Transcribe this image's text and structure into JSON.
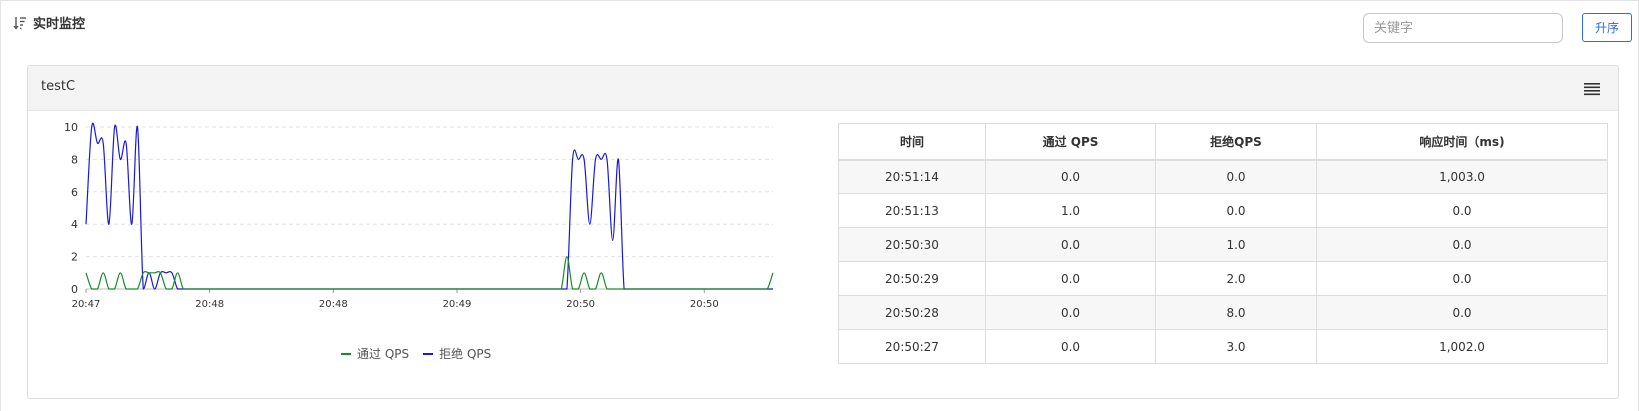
{
  "header": {
    "title": "实时监控",
    "search_placeholder": "关键字",
    "sort_label": "升序"
  },
  "panel": {
    "title": "testC"
  },
  "legend": {
    "pass": "通过 QPS",
    "block": "拒绝 QPS"
  },
  "colors": {
    "pass": "#1a8a2a",
    "block": "#1a1ad4",
    "accent": "#2d6cdf"
  },
  "table": {
    "headers": [
      "时间",
      "通过 QPS",
      "拒绝QPS",
      "响应时间（ms)"
    ],
    "rows": [
      [
        "20:51:14",
        "0.0",
        "0.0",
        "1,003.0"
      ],
      [
        "20:51:13",
        "1.0",
        "0.0",
        "0.0"
      ],
      [
        "20:50:30",
        "0.0",
        "1.0",
        "0.0"
      ],
      [
        "20:50:29",
        "0.0",
        "2.0",
        "0.0"
      ],
      [
        "20:50:28",
        "0.0",
        "8.0",
        "0.0"
      ],
      [
        "20:50:27",
        "0.0",
        "3.0",
        "1,002.0"
      ]
    ]
  },
  "chart_data": {
    "type": "line",
    "xlabel": "",
    "ylabel": "",
    "ylim": [
      0,
      10
    ],
    "yticks": [
      0,
      2,
      4,
      6,
      8,
      10
    ],
    "xticks": [
      "20:47",
      "20:48",
      "20:48",
      "20:49",
      "20:50",
      "20:50"
    ],
    "grid": true,
    "legend_position": "bottom",
    "x": [
      0,
      1,
      2,
      3,
      4,
      5,
      6,
      7,
      8,
      9,
      10,
      11,
      12,
      13,
      14,
      15,
      16,
      17,
      18,
      19,
      20,
      21,
      22,
      23,
      24,
      25,
      26,
      27,
      28,
      29,
      30,
      31,
      32,
      33,
      34,
      35,
      36,
      37,
      38,
      39,
      40,
      41,
      42,
      43,
      44,
      45,
      46,
      47,
      48,
      49,
      50,
      51,
      52,
      53,
      54,
      55,
      56,
      57,
      58,
      59,
      60,
      61,
      62,
      63,
      64,
      65,
      66,
      67,
      68,
      69,
      70,
      71,
      72,
      73,
      74,
      75,
      76,
      77,
      78,
      79,
      80,
      81,
      82,
      83,
      84,
      85,
      86,
      87,
      88,
      89,
      90,
      91,
      92,
      93,
      94,
      95,
      96,
      97,
      98,
      99,
      100,
      101,
      102,
      103,
      104,
      105,
      106,
      107,
      108,
      109,
      110,
      111,
      112,
      113,
      114,
      115,
      116,
      117,
      118,
      119,
      120
    ],
    "series": [
      {
        "name": "通过 QPS",
        "values": [
          1,
          0,
          0,
          1,
          0,
          0,
          1,
          0,
          0,
          0,
          1,
          1,
          1,
          1,
          0,
          0,
          1,
          0,
          0,
          0,
          0,
          0,
          0,
          0,
          0,
          0,
          0,
          0,
          0,
          0,
          0,
          0,
          0,
          0,
          0,
          0,
          0,
          0,
          0,
          0,
          0,
          0,
          0,
          0,
          0,
          0,
          0,
          0,
          0,
          0,
          0,
          0,
          0,
          0,
          0,
          0,
          0,
          0,
          0,
          0,
          0,
          0,
          0,
          0,
          0,
          0,
          0,
          0,
          0,
          0,
          0,
          0,
          0,
          0,
          0,
          0,
          0,
          0,
          0,
          0,
          0,
          0,
          0,
          0,
          2,
          0,
          0,
          1,
          0,
          0,
          1,
          0,
          0,
          0,
          0,
          0,
          0,
          0,
          0,
          0,
          0,
          0,
          0,
          0,
          0,
          0,
          0,
          0,
          0,
          0,
          0,
          0,
          0,
          0,
          0,
          0,
          0,
          0,
          0,
          0,
          1
        ]
      },
      {
        "name": "拒绝 QPS",
        "values": [
          4,
          10,
          9,
          9,
          4,
          10,
          8,
          9,
          4,
          10,
          0,
          1,
          0,
          1,
          1,
          1,
          0,
          0,
          0,
          0,
          0,
          0,
          0,
          0,
          0,
          0,
          0,
          0,
          0,
          0,
          0,
          0,
          0,
          0,
          0,
          0,
          0,
          0,
          0,
          0,
          0,
          0,
          0,
          0,
          0,
          0,
          0,
          0,
          0,
          0,
          0,
          0,
          0,
          0,
          0,
          0,
          0,
          0,
          0,
          0,
          0,
          0,
          0,
          0,
          0,
          0,
          0,
          0,
          0,
          0,
          0,
          0,
          0,
          0,
          0,
          0,
          0,
          0,
          0,
          0,
          0,
          0,
          0,
          0,
          0,
          8,
          8,
          8,
          4,
          8,
          8,
          8,
          3,
          8,
          0,
          0,
          0,
          0,
          0,
          0,
          0,
          0,
          0,
          0,
          0,
          0,
          0,
          0,
          0,
          0,
          0,
          0,
          0,
          0,
          0,
          0,
          0,
          0,
          0,
          0,
          0
        ]
      }
    ]
  }
}
